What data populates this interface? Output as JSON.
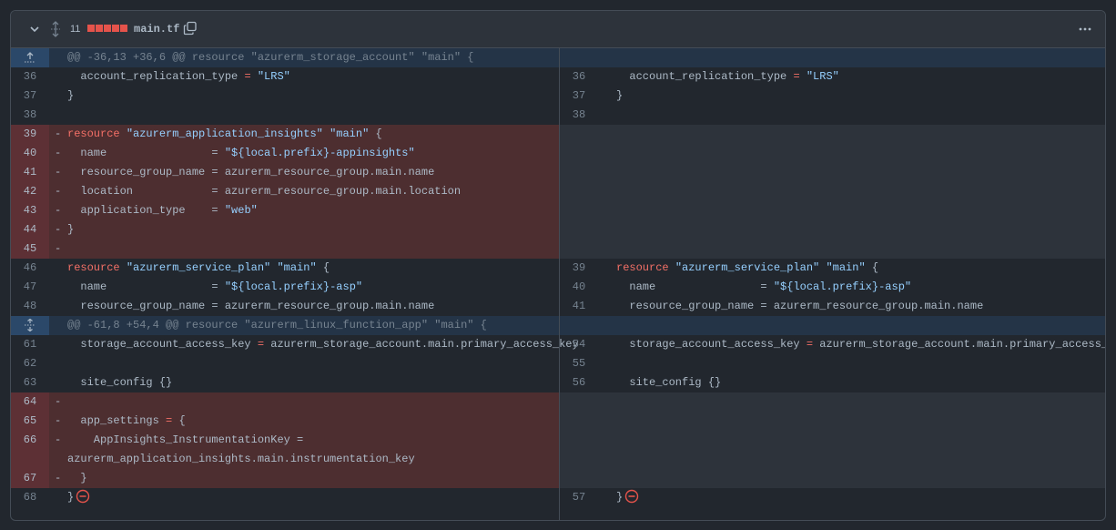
{
  "file": {
    "change_count": "11",
    "file_name": "main.tf"
  },
  "colors": {
    "deleted_line": "#4d2e30",
    "deleted_number": "#5d3035",
    "hunk": "#243447",
    "keyword": "#f47067",
    "string": "#96d0ff"
  },
  "hunks": [
    "@@ -36,13 +36,6 @@ resource \"azurerm_storage_account\" \"main\" {",
    "@@ -61,8 +54,4 @@ resource \"azurerm_linux_function_app\" \"main\" {"
  ],
  "lines": {
    "l36": "36",
    "l37": "37",
    "l38": "38",
    "l39": "39",
    "l40": "40",
    "l41": "41",
    "l42": "42",
    "l43": "43",
    "l44": "44",
    "l45": "45",
    "l46": "46",
    "l47": "47",
    "l48": "48",
    "l61": "61",
    "l62": "62",
    "l63": "63",
    "l64": "64",
    "l65": "65",
    "l66": "66",
    "l67": "67",
    "l68": "68",
    "r36": "36",
    "r37": "37",
    "r38": "38",
    "r39": "39",
    "r40": "40",
    "r41": "41",
    "r54": "54",
    "r55": "55",
    "r56": "56",
    "r57": "57"
  },
  "code": {
    "replication_key": "  account_replication_type",
    "replication_val": "\"LRS\"",
    "close_brace": "  }",
    "resource_kw": "resource",
    "ai_type": "\"azurerm_application_insights\"",
    "main": "\"main\"",
    "open_brace": "{",
    "name_key": "  name                =",
    "ai_name_pre": "\"${",
    "local": "local",
    "ai_name_mid": ".prefix",
    "ai_name_post": "}-appinsights\"",
    "rg_key": "  resource_group_name = azurerm_resource_group.main.name",
    "location": "  location            = azurerm_resource_group.main.location",
    "app_type_key": "  application_type    =",
    "app_type_val": "\"web\"",
    "brace_only": "}",
    "sp_type": "\"azurerm_service_plan\"",
    "asp_post": "}-asp\"",
    "storage_key": "  storage_account_access_key",
    "storage_val": "azurerm_storage_account.main.primary_access_key",
    "site_config": "  site_config {}",
    "app_settings": "  app_settings",
    "instr_key": "    AppInsights_InstrumentationKey =",
    "instr_val": "azurerm_application_insights.main.instrumentation_key"
  }
}
